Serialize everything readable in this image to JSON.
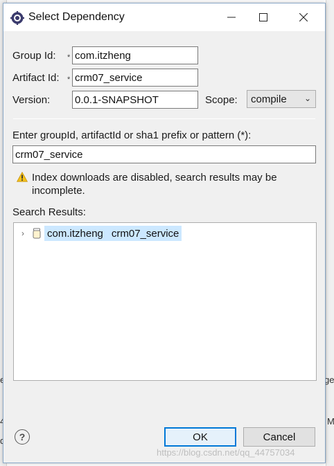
{
  "background": {
    "fragment_left_1": "e",
    "fragment_left_2": "4",
    "fragment_left_3": "d",
    "fragment_right_1": "ge",
    "fragment_right_2": "M"
  },
  "dialog": {
    "title": "Select Dependency",
    "group_id_label": "Group Id:",
    "group_id_value": "com.itzheng",
    "artifact_id_label": "Artifact Id:",
    "artifact_id_value": "crm07_service",
    "version_label": "Version:",
    "version_value": "0.0.1-SNAPSHOT",
    "scope_label": "Scope:",
    "scope_value": "compile",
    "required_marker": "*",
    "search_label": "Enter groupId, artifactId or sha1 prefix or pattern (*):",
    "search_value": "crm07_service",
    "warning_line1": "Index downloads are disabled, search results may be",
    "warning_line2": "incomplete.",
    "results_label": "Search Results:",
    "results": [
      {
        "group": "com.itzheng",
        "artifact": "crm07_service"
      }
    ],
    "ok_label": "OK",
    "cancel_label": "Cancel",
    "help_symbol": "?"
  },
  "watermark": "https://blog.csdn.net/qq_44757034",
  "colors": {
    "selection": "#cce8ff",
    "default_button_border": "#0078d7",
    "warning": "#e8b400"
  }
}
